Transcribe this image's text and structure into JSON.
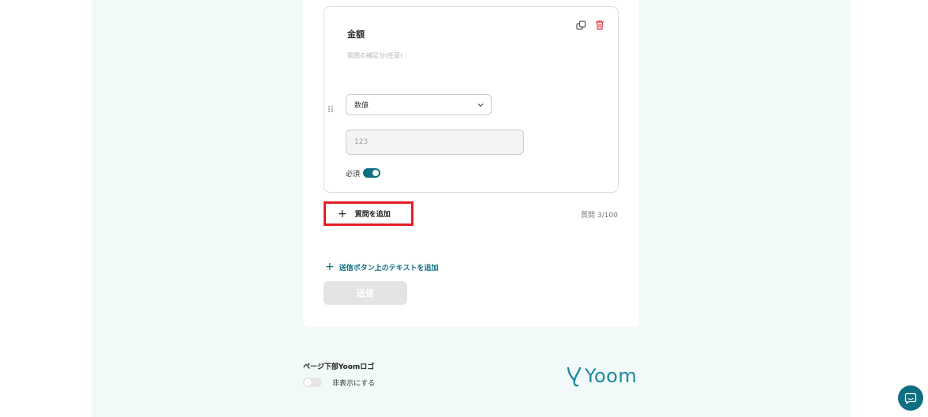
{
  "question": {
    "title": "金額",
    "description_placeholder": "質問の補足分(任意)",
    "type_select": "数値",
    "number_placeholder": "123",
    "required_label": "必須",
    "required_on": true
  },
  "actions": {
    "add_question_label": "質問を追加",
    "question_count": "質問 3/100",
    "add_text_label": "送信ボタン上のテキストを追加",
    "submit_label": "送信"
  },
  "footer": {
    "logo_section_label": "ページ下部Yoomロゴ",
    "hide_label": "非表示にする",
    "hide_on": false,
    "brand": "Yoom"
  },
  "colors": {
    "accent": "#0e6f80",
    "highlight": "#e31e24",
    "background": "#f1faf8",
    "brand": "#1e8aa0"
  },
  "icons": [
    "copy-icon",
    "trash-icon",
    "drag-handle-icon",
    "chevron-down-icon",
    "plus-icon",
    "chat-icon"
  ]
}
